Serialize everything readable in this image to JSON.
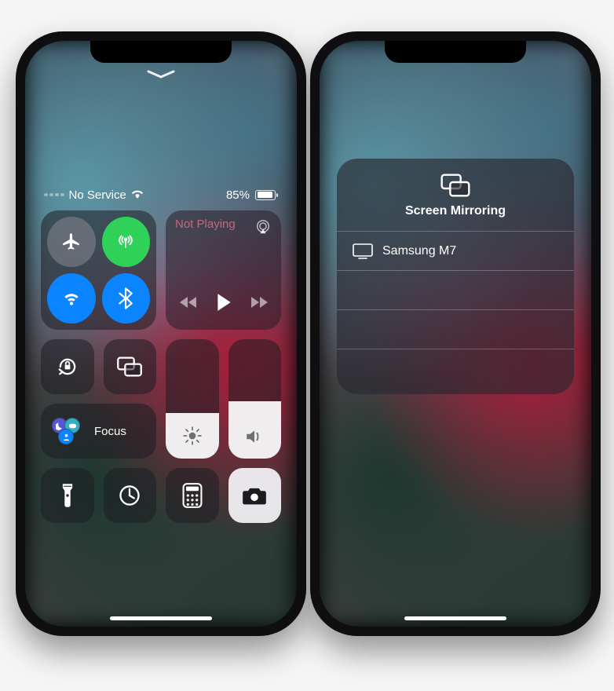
{
  "status": {
    "network": "No Service",
    "battery_pct_label": "85%",
    "battery_pct": 85
  },
  "connectivity": {
    "airplane": {
      "on": false
    },
    "cellular": {
      "on": true
    },
    "wifi": {
      "on": true
    },
    "bluetooth": {
      "on": true
    }
  },
  "media": {
    "title": "Not Playing"
  },
  "focus": {
    "label": "Focus"
  },
  "sliders": {
    "brightness_pct": 38,
    "volume_pct": 48
  },
  "mirror": {
    "title": "Screen Mirroring",
    "devices": [
      "Samsung M7"
    ]
  },
  "icons": {
    "airplay": "airplay-icon",
    "tv": "tv-icon"
  }
}
